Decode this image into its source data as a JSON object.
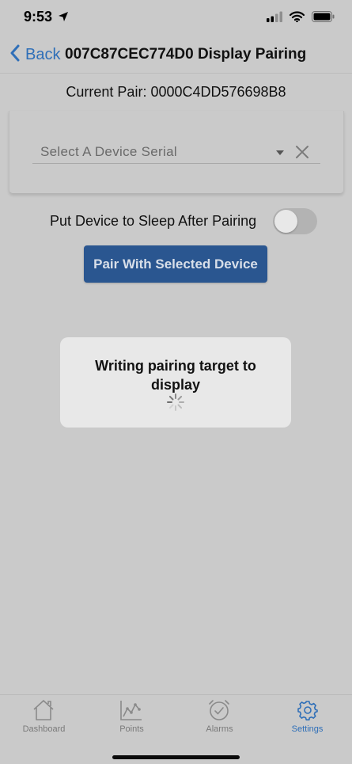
{
  "status_bar": {
    "time": "9:53",
    "icons": [
      "location-arrow-icon",
      "cellular-signal-icon",
      "wifi-icon",
      "battery-icon"
    ]
  },
  "nav": {
    "back_label": "Back",
    "title": "007C87CEC774D0 Display Pairing"
  },
  "current_pair": "Current Pair: 0000C4DD576698B8",
  "device_select": {
    "placeholder": "Select A Device Serial",
    "selected": ""
  },
  "sleep_toggle": {
    "label": "Put Device to Sleep After Pairing",
    "on": false
  },
  "pair_button": {
    "label": "Pair With Selected Device"
  },
  "loading": {
    "message": "Writing pairing target to display"
  },
  "tabs": [
    {
      "label": "Dashboard",
      "icon": "house-icon",
      "active": false
    },
    {
      "label": "Points",
      "icon": "line-chart-icon",
      "active": false
    },
    {
      "label": "Alarms",
      "icon": "alarm-clock-icon",
      "active": false
    },
    {
      "label": "Settings",
      "icon": "gear-icon",
      "active": true
    }
  ],
  "colors": {
    "background": "#cacaca",
    "accent": "#2f6fb8",
    "button": "#2a5690",
    "dialog": "#e8e8e8"
  }
}
